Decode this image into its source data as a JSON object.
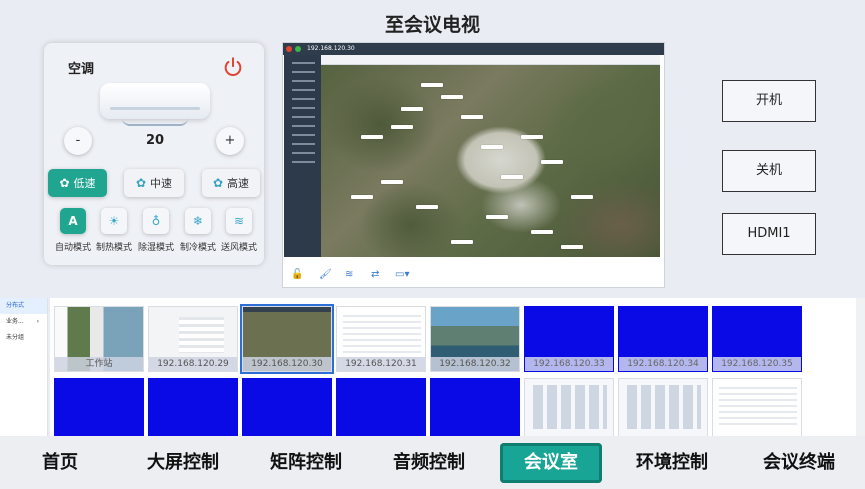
{
  "page": {
    "title": "至会议电视"
  },
  "ac": {
    "title": "空调",
    "temperature": "20",
    "minus_label": "-",
    "plus_label": "+",
    "speeds": [
      {
        "label": "低速",
        "active": true
      },
      {
        "label": "中速",
        "active": false
      },
      {
        "label": "高速",
        "active": false
      }
    ],
    "modes": [
      {
        "label": "自动模式",
        "icon_text": "A",
        "active": true
      },
      {
        "label": "制热模式",
        "icon_text": "☀",
        "active": false
      },
      {
        "label": "除湿模式",
        "icon_text": "♁",
        "active": false
      },
      {
        "label": "制冷模式",
        "icon_text": "❄",
        "active": false
      },
      {
        "label": "送风模式",
        "icon_text": "≋",
        "active": false
      }
    ]
  },
  "remote": {
    "address": "192.168.120.30"
  },
  "controls": {
    "power_on": "开机",
    "power_off": "关机",
    "hdmi": "HDMI1"
  },
  "tree": {
    "items": [
      {
        "label": "分布式"
      },
      {
        "label": "业务..."
      },
      {
        "label": "未分组"
      }
    ]
  },
  "thumbnails": {
    "row1": [
      {
        "caption": "工作站"
      },
      {
        "caption": "192.168.120.29"
      },
      {
        "caption": "192.168.120.30"
      },
      {
        "caption": "192.168.120.31"
      },
      {
        "caption": "192.168.120.32"
      },
      {
        "caption": "192.168.120.33"
      },
      {
        "caption": "192.168.120.34"
      },
      {
        "caption": "192.168.120.35"
      }
    ]
  },
  "nav": {
    "items": [
      {
        "label": "首页"
      },
      {
        "label": "大屏控制"
      },
      {
        "label": "矩阵控制"
      },
      {
        "label": "音频控制"
      },
      {
        "label": "会议室",
        "active": true
      },
      {
        "label": "环境控制"
      },
      {
        "label": "会议终端"
      }
    ]
  },
  "colors": {
    "accent": "#19a595",
    "power": "#e0452f",
    "offline_blue": "#0a0ae6"
  },
  "icons": [
    "power-icon",
    "fan-icon",
    "sun-icon",
    "droplet-icon",
    "snowflake-icon",
    "wind-icon",
    "chevron-right-icon"
  ]
}
